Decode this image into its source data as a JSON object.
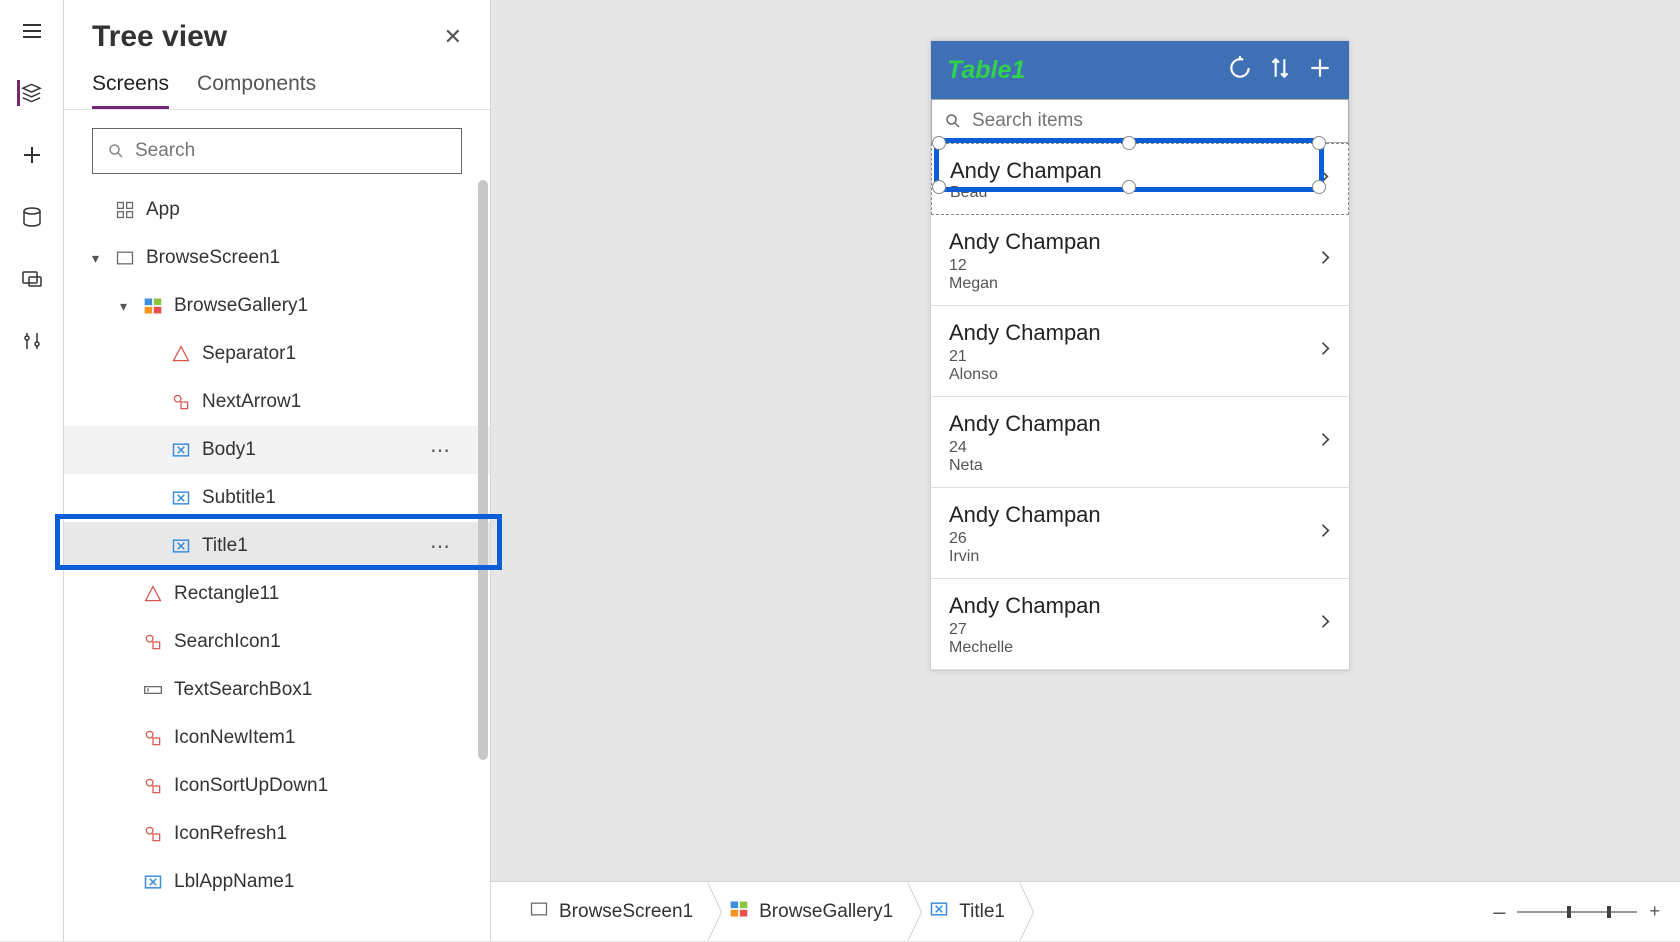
{
  "tree": {
    "title": "Tree view",
    "tabs": {
      "screens": "Screens",
      "components": "Components"
    },
    "search_placeholder": "Search",
    "items": [
      {
        "label": "App",
        "icon": "grid",
        "indent": 0,
        "chev": ""
      },
      {
        "label": "BrowseScreen1",
        "icon": "rect",
        "indent": 0,
        "chev": "down"
      },
      {
        "label": "BrowseGallery1",
        "icon": "gallery",
        "indent": 1,
        "chev": "down"
      },
      {
        "label": "Separator1",
        "icon": "shape",
        "indent": 2
      },
      {
        "label": "NextArrow1",
        "icon": "iconctl",
        "indent": 2
      },
      {
        "label": "Body1",
        "icon": "label",
        "indent": 2,
        "hover": true
      },
      {
        "label": "Subtitle1",
        "icon": "label",
        "indent": 2
      },
      {
        "label": "Title1",
        "icon": "label",
        "indent": 2,
        "selected": true
      },
      {
        "label": "Rectangle11",
        "icon": "shape",
        "indent": 1
      },
      {
        "label": "SearchIcon1",
        "icon": "iconctl",
        "indent": 1
      },
      {
        "label": "TextSearchBox1",
        "icon": "textbox",
        "indent": 1
      },
      {
        "label": "IconNewItem1",
        "icon": "iconctl",
        "indent": 1
      },
      {
        "label": "IconSortUpDown1",
        "icon": "iconctl",
        "indent": 1
      },
      {
        "label": "IconRefresh1",
        "icon": "iconctl",
        "indent": 1
      },
      {
        "label": "LblAppName1",
        "icon": "label",
        "indent": 1
      }
    ]
  },
  "phone": {
    "title": "Table1",
    "search_placeholder": "Search items",
    "rows": [
      {
        "title": "Andy Champan",
        "sub1": "",
        "sub2": "Beau"
      },
      {
        "title": "Andy Champan",
        "sub1": "12",
        "sub2": "Megan"
      },
      {
        "title": "Andy Champan",
        "sub1": "21",
        "sub2": "Alonso"
      },
      {
        "title": "Andy Champan",
        "sub1": "24",
        "sub2": "Neta"
      },
      {
        "title": "Andy Champan",
        "sub1": "26",
        "sub2": "Irvin"
      },
      {
        "title": "Andy Champan",
        "sub1": "27",
        "sub2": "Mechelle"
      }
    ]
  },
  "breadcrumb": [
    {
      "label": "BrowseScreen1",
      "icon": "rect"
    },
    {
      "label": "BrowseGallery1",
      "icon": "gallery"
    },
    {
      "label": "Title1",
      "icon": "label"
    }
  ],
  "zoom": {
    "minus": "–",
    "plus": "+"
  }
}
